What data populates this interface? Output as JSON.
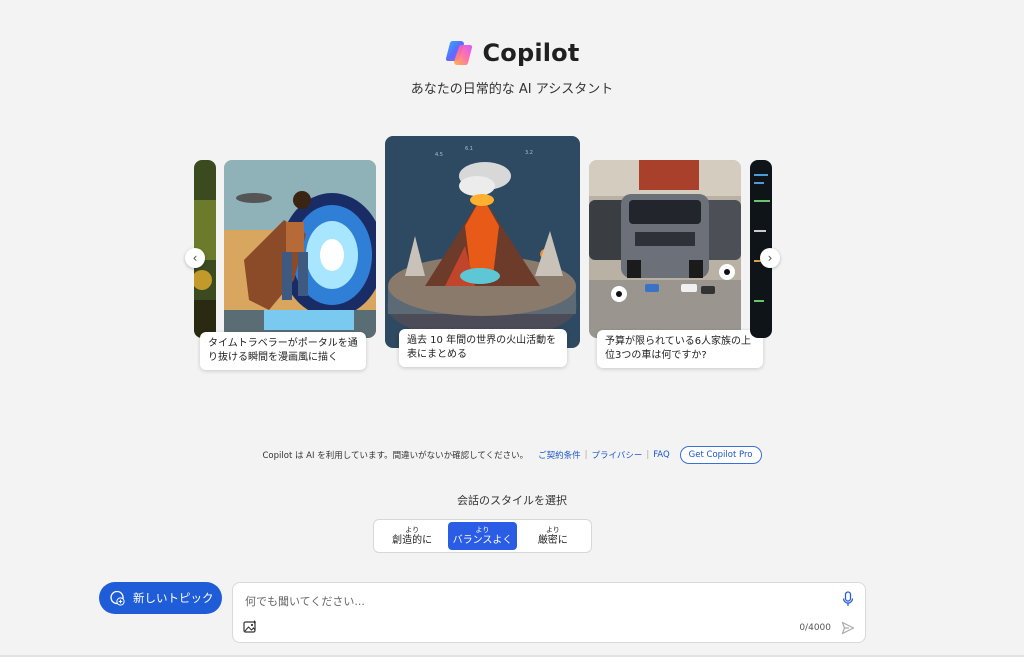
{
  "header": {
    "brand_name": "Copilot",
    "subtitle": "あなたの日常的な AI アシスタント"
  },
  "carousel": {
    "prev_icon": "chevron-left-icon",
    "next_icon": "chevron-right-icon",
    "cards": [
      {
        "caption": "タイムトラベラーがポータルを通り抜ける瞬間を漫画風に描く",
        "icon": "comic-time-traveler-image"
      },
      {
        "caption": "過去 10 年間の世界の火山活動を表にまとめる",
        "icon": "volcano-image"
      },
      {
        "caption": "予算が限られている6人家族の上位3つの車は何ですか?",
        "icon": "suv-image"
      }
    ]
  },
  "disclaimer": {
    "text": "Copilot は AI を利用しています。間違いがないか確認してください。",
    "terms": "ご契約条件",
    "privacy": "プライバシー",
    "faq": "FAQ",
    "pro_button": "Get Copilot Pro"
  },
  "style_selector": {
    "title": "会話のスタイルを選択",
    "options": [
      {
        "small": "より",
        "main": "創造的に",
        "active": false
      },
      {
        "small": "より",
        "main": "バランスよく",
        "active": true
      },
      {
        "small": "より",
        "main": "厳密に",
        "active": false
      }
    ]
  },
  "new_topic": {
    "label": "新しいトピック",
    "icon": "chat-plus-icon"
  },
  "input": {
    "placeholder": "何でも聞いてください...",
    "counter": "0/4000",
    "mic_icon": "microphone-icon",
    "image_icon": "image-upload-icon",
    "send_icon": "send-icon"
  },
  "colors": {
    "accent": "#1f5dd8",
    "background": "#f3f3f3"
  }
}
